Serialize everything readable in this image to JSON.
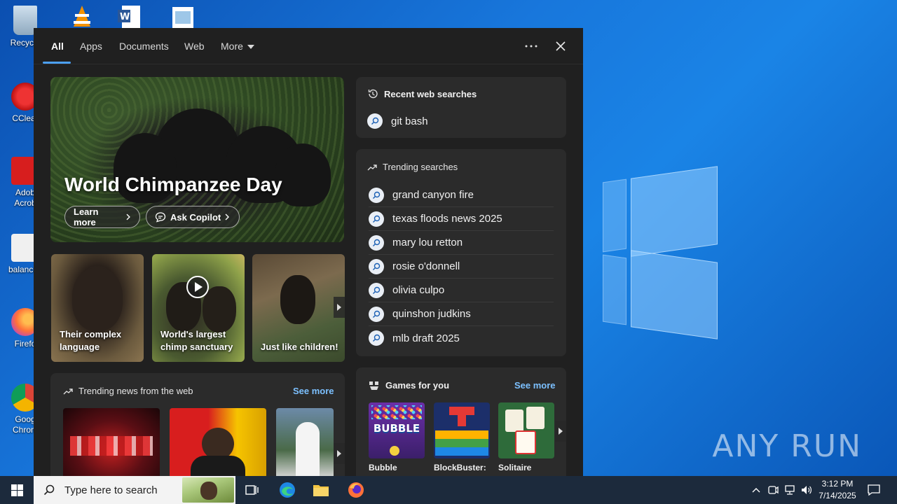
{
  "desktop": {
    "icons": [
      {
        "label": "Recycle"
      },
      {
        "label": "CClear"
      },
      {
        "label": "Adob Acrob"
      },
      {
        "label": "balancev"
      },
      {
        "label": "Firefo"
      },
      {
        "label": "Goog Chrom"
      }
    ],
    "watermark": "ANY RUN"
  },
  "search_panel": {
    "tabs": [
      {
        "label": "All",
        "active": true
      },
      {
        "label": "Apps"
      },
      {
        "label": "Documents"
      },
      {
        "label": "Web"
      },
      {
        "label": "More"
      }
    ],
    "hero": {
      "title": "World Chimpanzee Day",
      "learn_more": "Learn more",
      "ask_copilot": "Ask Copilot"
    },
    "cards": [
      {
        "caption": "Their complex language"
      },
      {
        "caption": "World's largest chimp sanctuary",
        "video": true
      },
      {
        "caption": "Just like children!"
      }
    ],
    "trending_news": {
      "heading": "Trending news from the web",
      "see_more": "See more"
    },
    "recent_searches": {
      "heading": "Recent web searches",
      "items": [
        "git bash"
      ]
    },
    "trending_searches": {
      "heading": "Trending searches",
      "items": [
        "grand canyon fire",
        "texas floods news 2025",
        "mary lou retton",
        "rosie o'donnell",
        "olivia culpo",
        "quinshon judkins",
        "mlb draft 2025"
      ]
    },
    "games": {
      "heading": "Games for you",
      "see_more": "See more",
      "items": [
        {
          "name": "Bubble",
          "tile_text": "BUBBLE"
        },
        {
          "name": "BlockBuster:"
        },
        {
          "name": "Solitaire"
        }
      ]
    }
  },
  "taskbar": {
    "search_placeholder": "Type here to search",
    "time": "3:12 PM",
    "date": "7/14/2025"
  },
  "colors": {
    "accent": "#4ca0f5",
    "link": "#7cc0ff",
    "panel_bg": "#202020",
    "box_bg": "#2b2b2b",
    "taskbar": "#1c2a3c"
  }
}
